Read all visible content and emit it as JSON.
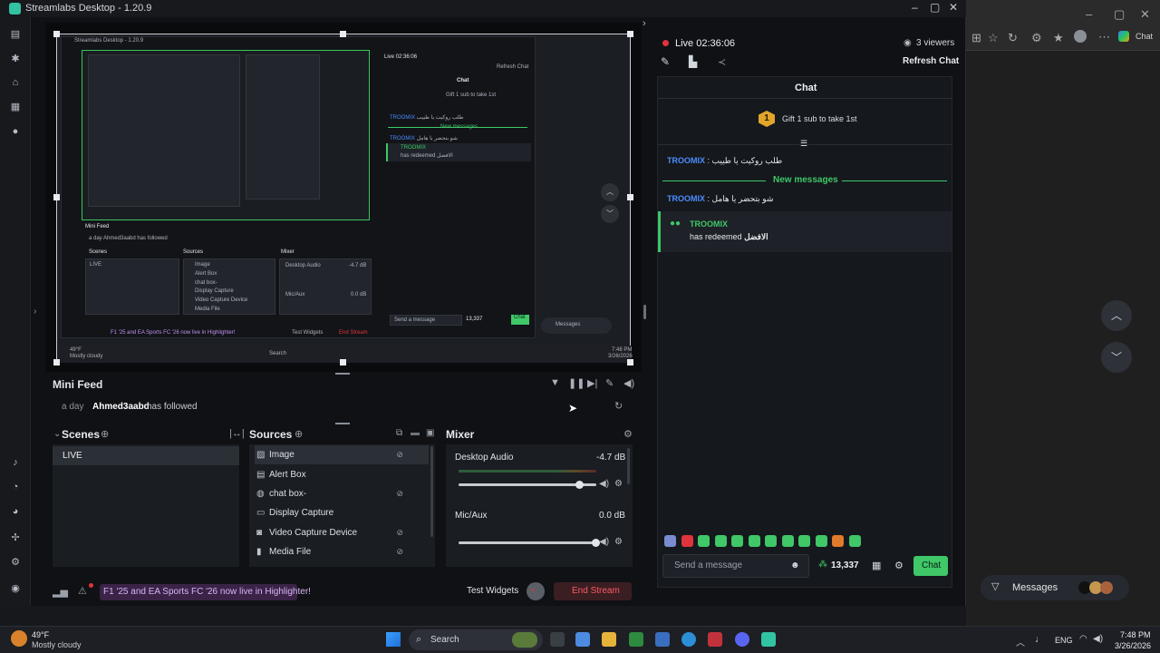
{
  "window": {
    "title": "Streamlabs Desktop - 1.20.9"
  },
  "preview": {
    "nested_title": "Streamlabs Desktop - 1.20.9",
    "nested_live": "Live 02:36:06",
    "nested_refresh": "Refresh Chat",
    "nested_chat": "Chat",
    "nested_gift": "Gift 1 sub to take 1st",
    "nested_user1": "TROOMIX",
    "nested_msg1": "طلب روكيت يا طييب",
    "nested_new": "New messages",
    "nested_user2": "TROOMIX",
    "nested_msg2": "شو بتحضر يا هامل",
    "nested_user3": "TROOMIX",
    "nested_redeem": "has redeemed الافضل",
    "nested_minifeed": "Mini Feed",
    "nested_feed": "a day   Ahmed3aabd   has followed",
    "nested_scenes": "Scenes",
    "nested_sources": "Sources",
    "nested_mixer": "Mixer",
    "nested_live_scene": "LIVE",
    "nested_src": [
      "Image",
      "Alert Box",
      "chat box-",
      "Display Capture",
      "Video Capture Device",
      "Media File"
    ],
    "nested_desktop_audio": "Desktop Audio",
    "nested_desktop_db": "-4.7 dB",
    "nested_mic": "Mic/Aux",
    "nested_mic_db": "0.0 dB",
    "nested_promo": "F1 '25 and EA Sports FC '26 now live in Highlighter!",
    "nested_test": "Test Widgets",
    "nested_end": "End Stream",
    "nested_send": "Send a message",
    "nested_points": "13,337",
    "nested_chat_btn": "Chat",
    "nested_messages": "Messages",
    "nested_search": "Search",
    "nested_weather_temp": "49°F",
    "nested_weather_desc": "Mostly cloudy",
    "nested_time": "7:48 PM",
    "nested_date": "3/26/2026"
  },
  "minifeed": {
    "title": "Mini Feed",
    "time": "a day",
    "user": "Ahmed3aabd",
    "action": "has followed"
  },
  "scenes": {
    "title": "Scenes",
    "items": [
      "LIVE"
    ]
  },
  "sources": {
    "title": "Sources",
    "items": [
      "Image",
      "Alert Box",
      "chat box-",
      "Display Capture",
      "Video Capture Device",
      "Media File"
    ]
  },
  "mixer": {
    "title": "Mixer",
    "channels": [
      {
        "name": "Desktop Audio",
        "db": "-4.7 dB",
        "level": 0.88
      },
      {
        "name": "Mic/Aux",
        "db": "0.0 dB",
        "level": 1.0
      }
    ]
  },
  "footer": {
    "promo": "F1 '25 and EA Sports FC '26 now live in Highlighter!",
    "test_widgets": "Test Widgets",
    "end_stream": "End Stream"
  },
  "stream": {
    "live_time": "Live 02:36:06",
    "viewers": "3 viewers",
    "refresh": "Refresh Chat"
  },
  "chat": {
    "title": "Chat",
    "gift": "Gift 1 sub to take 1st",
    "gift_badge": "1",
    "messages": [
      {
        "user": "TROOMIX",
        "text": "طلب روكيت يا طييب"
      },
      {
        "user": "TROOMIX",
        "text": "شو بتحضر يا هامل"
      }
    ],
    "new_messages": "New messages",
    "redeem_user": "TROOMIX",
    "redeem_text": "has redeemed",
    "redeem_item": "الافضل",
    "send_placeholder": "Send a message",
    "points": "13,337",
    "chat_button": "Chat"
  },
  "browser": {
    "chat_label": "Chat",
    "messages": "Messages"
  },
  "taskbar": {
    "weather_temp": "49°F",
    "weather_desc": "Mostly cloudy",
    "search": "Search",
    "lang": "ENG",
    "time": "7:48 PM",
    "date": "3/26/2026"
  },
  "colors": {
    "accent_green": "#31c3a2",
    "chat_green": "#3fc768",
    "end_stream_red": "#e0343d",
    "username_blue": "#4c8cff"
  }
}
